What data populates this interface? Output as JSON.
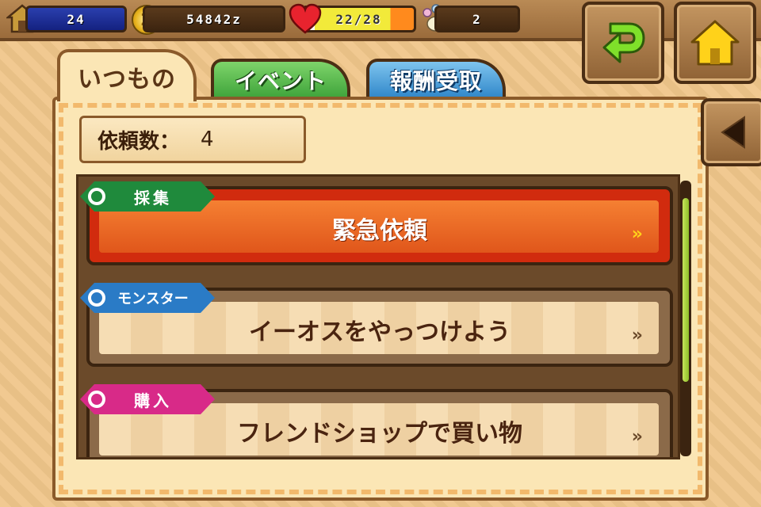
{
  "status_bar": {
    "rank": "24",
    "zenny": "54842z",
    "hp": "22/28",
    "hp_fraction": 0.786,
    "paws": "2"
  },
  "nav": {
    "back_icon": "green-return-arrow-icon",
    "home_icon": "yellow-house-icon",
    "side_icon": "left-triangle-icon"
  },
  "tabs": [
    {
      "label": "いつもの",
      "active": true
    },
    {
      "label": "イベント",
      "active": false
    },
    {
      "label": "報酬受取",
      "active": false
    }
  ],
  "request_count": {
    "label": "依頼数：",
    "value": "4"
  },
  "quests": [
    {
      "category": "採集",
      "title": "緊急依頼",
      "color": "#e0561b"
    },
    {
      "category": "モンスター",
      "title": "イーオスをやっつけよう",
      "color": "#2a7bc6"
    },
    {
      "category": "購入",
      "title": "フレンドショップで買い物",
      "color": "#d82a88"
    }
  ],
  "colors": {
    "category_gather": "#1f8a3c",
    "category_monster": "#2a7bc6",
    "category_buy": "#d82a88",
    "tab_event": "#3ea33a",
    "tab_reward": "#2f86c9"
  }
}
